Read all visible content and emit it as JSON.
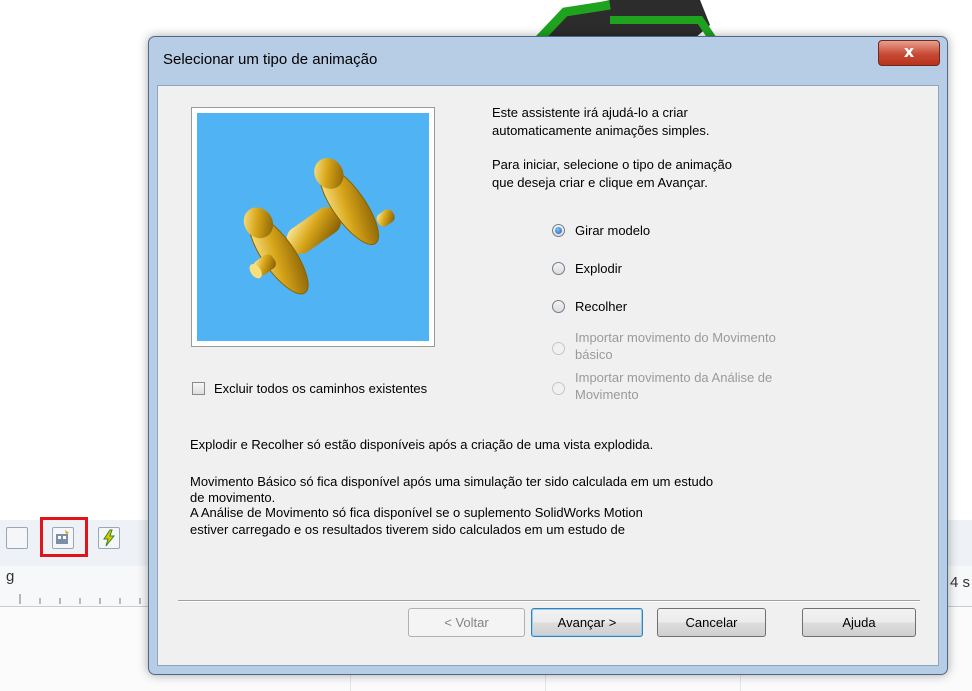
{
  "dialog": {
    "title": "Selecionar um tipo de animação",
    "close_glyph": "x",
    "intro": [
      "Este assistente irá ajudá-lo a criar",
      "automaticamente animações simples."
    ],
    "instruction": [
      "Para iniciar, selecione o tipo de animação",
      "que deseja criar e clique em Avançar."
    ],
    "options": [
      {
        "label": [
          "Girar modelo"
        ],
        "checked": true,
        "enabled": true
      },
      {
        "label": [
          "Explodir"
        ],
        "checked": false,
        "enabled": true
      },
      {
        "label": [
          "Recolher"
        ],
        "checked": false,
        "enabled": true
      },
      {
        "label": [
          "Importar movimento do Movimento",
          "básico"
        ],
        "checked": false,
        "enabled": false
      },
      {
        "label": [
          "Importar movimento da Análise de",
          "Movimento"
        ],
        "checked": false,
        "enabled": false
      }
    ],
    "checkbox_label": "Excluir todos os caminhos existentes",
    "checkbox_checked": false,
    "note1": "Explodir e Recolher só estão disponíveis após a criação de uma vista explodida.",
    "note2": [
      "Movimento Básico só fica disponível após uma simulação ter sido calculada em um estudo",
      "de movimento."
    ],
    "note3": [
      "A Análise de Movimento só fica disponível se o suplemento SolidWorks Motion",
      "estiver carregado e os resultados tiverem sido calculados em um estudo de"
    ],
    "buttons": {
      "back": "< Voltar",
      "next": "Avançar >",
      "cancel": "Cancelar",
      "help": "Ajuda"
    },
    "preview_color": "#4fb3f4"
  },
  "background": {
    "ruler_left": "g",
    "ruler_right": "4 s",
    "toolbar_icons": [
      "table-icon",
      "animation-wizard-icon",
      "calculate-icon"
    ],
    "highlight_color": "#e0141a"
  }
}
